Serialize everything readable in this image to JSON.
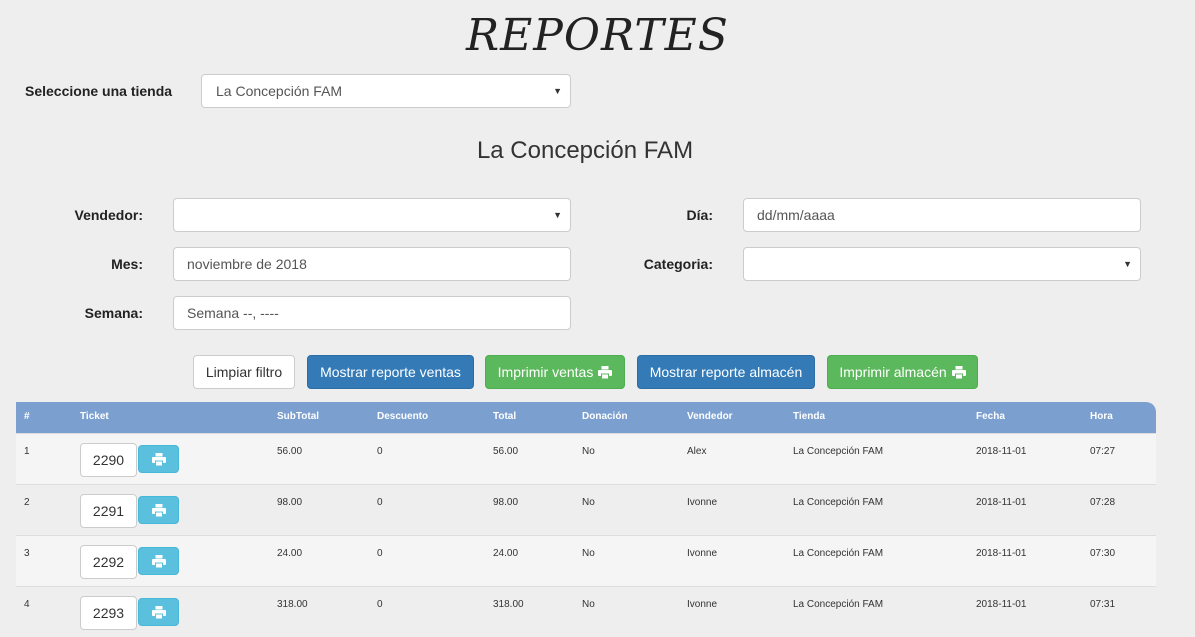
{
  "page": {
    "title": "REPORTES"
  },
  "store_select": {
    "label": "Seleccione una tienda",
    "value": "La Concepción FAM"
  },
  "store_heading": "La Concepción FAM",
  "filters": {
    "vendedor_label": "Vendedor:",
    "vendedor_value": "",
    "dia_label": "Día:",
    "dia_placeholder": "dd/mm/aaaa",
    "mes_label": "Mes:",
    "mes_value": "noviembre de 2018",
    "categoria_label": "Categoria:",
    "categoria_value": "",
    "semana_label": "Semana:",
    "semana_value": "Semana --, ----"
  },
  "buttons": {
    "clear": "Limpiar filtro",
    "show_sales": "Mostrar reporte ventas",
    "print_sales": "Imprimir ventas",
    "show_warehouse": "Mostrar reporte almacén",
    "print_warehouse": "Imprimir almacén"
  },
  "table": {
    "headers": [
      "#",
      "Ticket",
      "SubTotal",
      "Descuento",
      "Total",
      "Donación",
      "Vendedor",
      "Tienda",
      "Fecha",
      "Hora"
    ],
    "rows": [
      {
        "num": "1",
        "ticket": "2290",
        "subtotal": "56.00",
        "descuento": "0",
        "total": "56.00",
        "donacion": "No",
        "vendedor": "Alex",
        "tienda": "La Concepción FAM",
        "fecha": "2018-11-01",
        "hora": "07:27"
      },
      {
        "num": "2",
        "ticket": "2291",
        "subtotal": "98.00",
        "descuento": "0",
        "total": "98.00",
        "donacion": "No",
        "vendedor": "Ivonne",
        "tienda": "La Concepción FAM",
        "fecha": "2018-11-01",
        "hora": "07:28"
      },
      {
        "num": "3",
        "ticket": "2292",
        "subtotal": "24.00",
        "descuento": "0",
        "total": "24.00",
        "donacion": "No",
        "vendedor": "Ivonne",
        "tienda": "La Concepción FAM",
        "fecha": "2018-11-01",
        "hora": "07:30"
      },
      {
        "num": "4",
        "ticket": "2293",
        "subtotal": "318.00",
        "descuento": "0",
        "total": "318.00",
        "donacion": "No",
        "vendedor": "Ivonne",
        "tienda": "La Concepción FAM",
        "fecha": "2018-11-01",
        "hora": "07:31"
      }
    ]
  },
  "colors": {
    "primary": "#337ab7",
    "success": "#5cb85c",
    "info": "#5bc0de",
    "table_header": "#7b9fcf"
  },
  "icons": {
    "print": "print-icon",
    "caret": "caret-down-icon"
  }
}
